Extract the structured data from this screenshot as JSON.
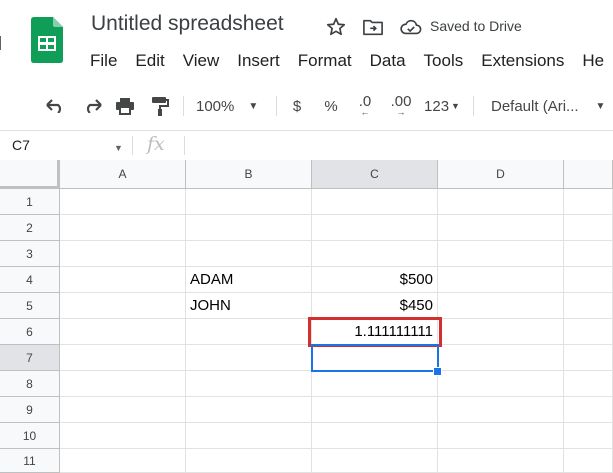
{
  "document": {
    "title": "Untitled spreadsheet",
    "save_status": "Saved to Drive"
  },
  "colors": {
    "accent": "#1a73e8",
    "sheets_green": "#0f9d58",
    "highlight_red": "#d32f2f"
  },
  "menu": [
    "File",
    "Edit",
    "View",
    "Insert",
    "Format",
    "Data",
    "Tools",
    "Extensions",
    "He"
  ],
  "toolbar": {
    "zoom": "100%",
    "currency": "$",
    "percent": "%",
    "decrease_decimal": ".0",
    "increase_decimal": ".00",
    "more_formats": "123",
    "font": "Default (Ari..."
  },
  "formula_bar": {
    "name_box": "C7",
    "fx": "fx"
  },
  "columns": [
    "A",
    "B",
    "C",
    "D"
  ],
  "rows": [
    "1",
    "2",
    "3",
    "4",
    "5",
    "6",
    "7",
    "8",
    "9",
    "10",
    "11"
  ],
  "cells": {
    "B4": "ADAM",
    "C4": "$500",
    "B5": "JOHN",
    "C5": "$450",
    "C6": "1.111111111"
  }
}
